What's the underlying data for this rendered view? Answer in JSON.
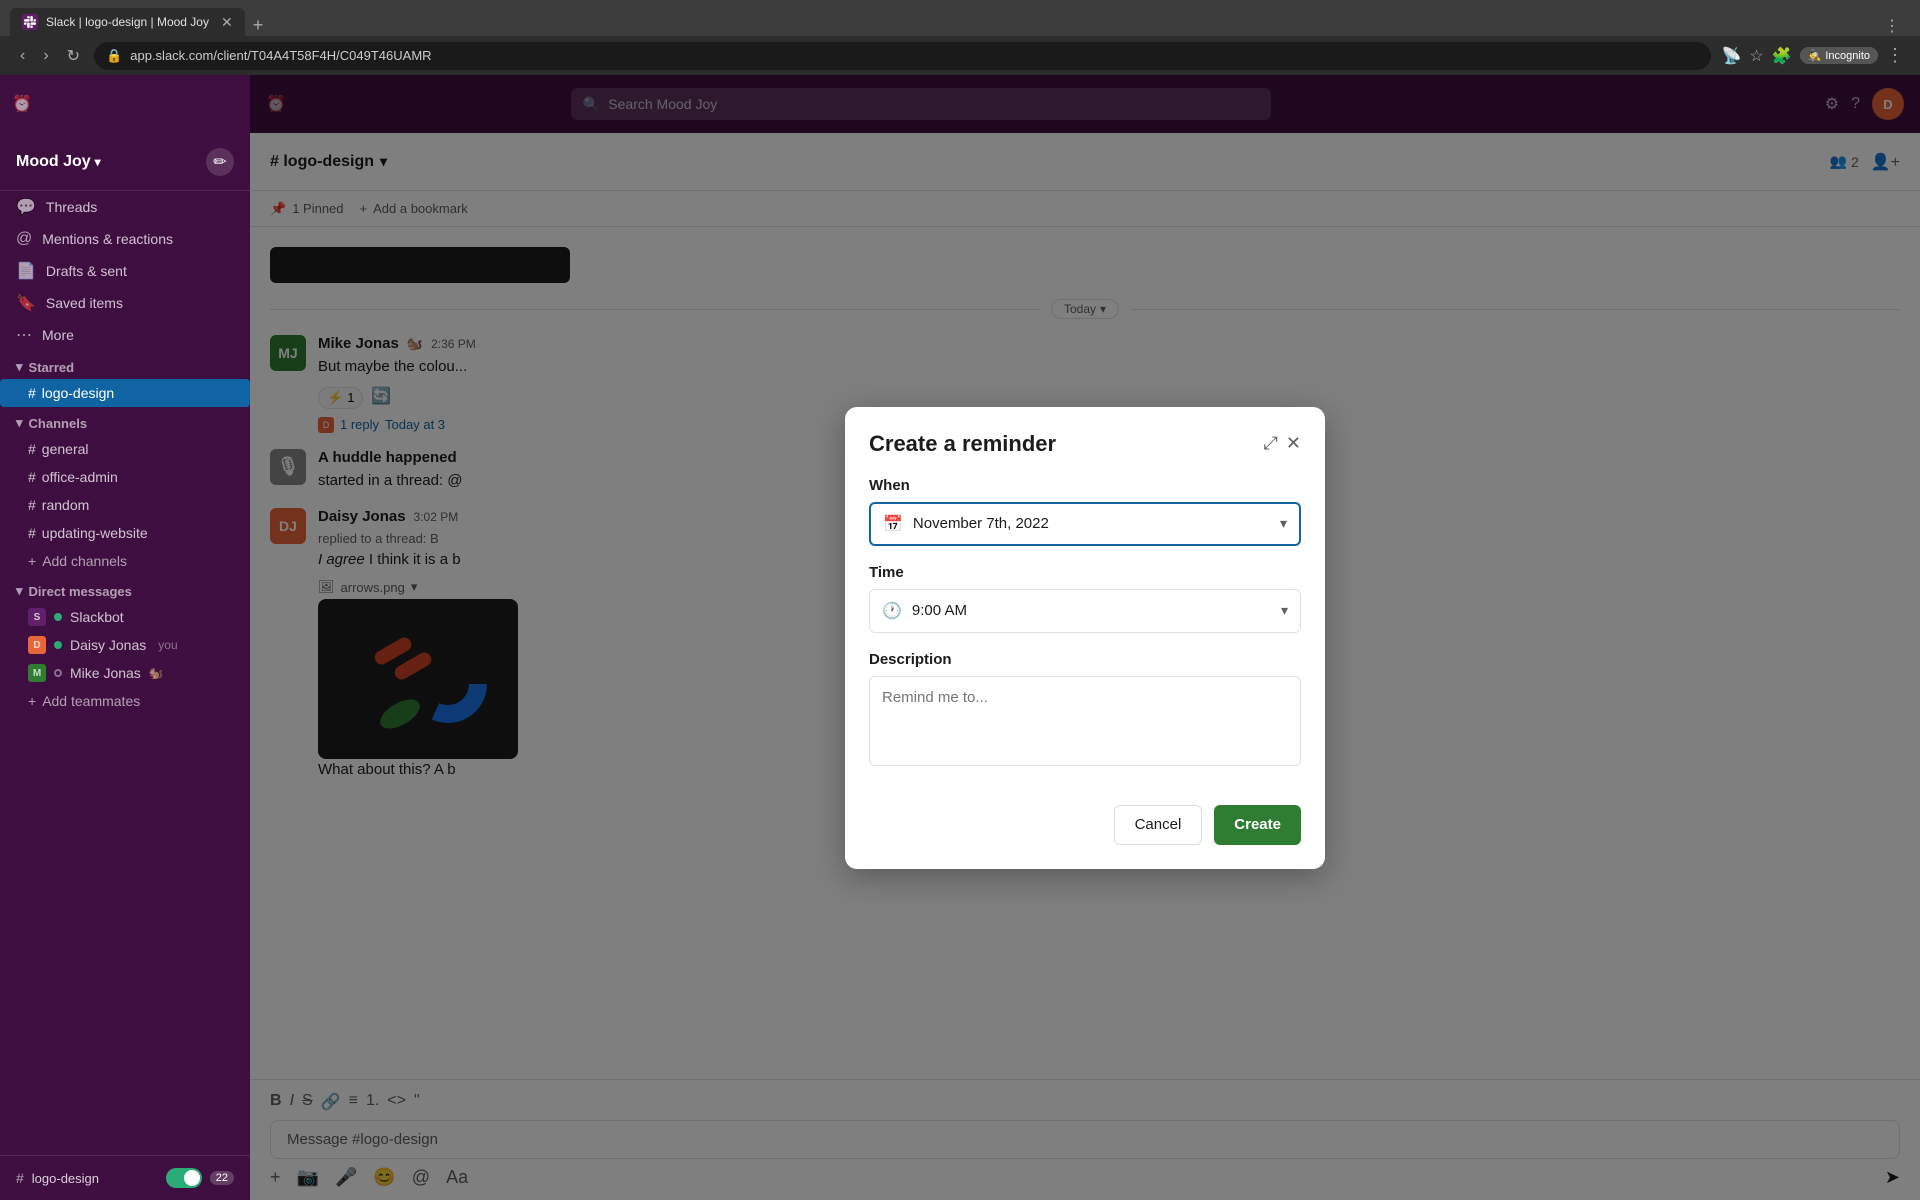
{
  "browser": {
    "tab_title": "Slack | logo-design | Mood Joy",
    "address": "app.slack.com/client/T04A4T58F4H/C049T46UAMR",
    "new_tab_label": "+",
    "incognito_label": "Incognito"
  },
  "topbar": {
    "search_placeholder": "Search Mood Joy",
    "history_icon": "⏰"
  },
  "sidebar": {
    "workspace_name": "Mood Joy",
    "nav_items": [
      {
        "id": "threads",
        "label": "Threads",
        "icon": "💬"
      },
      {
        "id": "mentions",
        "label": "Mentions & reactions",
        "icon": "🔔"
      },
      {
        "id": "drafts",
        "label": "Drafts & sent",
        "icon": "📄"
      },
      {
        "id": "saved",
        "label": "Saved items",
        "icon": "🔖"
      },
      {
        "id": "more",
        "label": "More",
        "icon": "•••"
      }
    ],
    "starred_section": "Starred",
    "starred_channels": [
      {
        "id": "logo-design",
        "label": "logo-design",
        "active": true
      }
    ],
    "channels_section": "Channels",
    "channels": [
      {
        "id": "general",
        "label": "general"
      },
      {
        "id": "office-admin",
        "label": "office-admin"
      },
      {
        "id": "random",
        "label": "random"
      },
      {
        "id": "updating-website",
        "label": "updating-website"
      }
    ],
    "add_channels_label": "Add channels",
    "dm_section": "Direct messages",
    "dms": [
      {
        "id": "slackbot",
        "label": "Slackbot",
        "color": "#611f69",
        "initials": "S",
        "active": true
      },
      {
        "id": "daisy",
        "label": "Daisy Jonas",
        "sub": "you",
        "color": "#e8643b",
        "initials": "DJ",
        "active": true
      },
      {
        "id": "mike",
        "label": "Mike Jonas",
        "emoji": "🐿️",
        "color": "#2e7d32",
        "initials": "MJ",
        "active": false
      }
    ],
    "add_teammates_label": "Add teammates",
    "footer_channel": "logo-design",
    "footer_badge": "22"
  },
  "channel": {
    "name": "# logo-design",
    "pinned_count": "1 Pinned",
    "add_bookmark": "Add a bookmark",
    "member_count": "2",
    "today_label": "Today",
    "date_label": "Today"
  },
  "messages": [
    {
      "id": "msg1",
      "author": "Mike Jonas",
      "author_emoji": "🐿️",
      "time": "2:36 PM",
      "text": "But maybe the colou...",
      "avatar_color": "#2e7d32",
      "initials": "MJ",
      "reply_count": "1 reply",
      "reply_time": "Today at 3",
      "reaction_emoji": "⚡",
      "reaction_count": "1"
    },
    {
      "id": "msg2",
      "author": "A huddle happened",
      "time": "",
      "text": "started in a thread: @",
      "avatar_color": "#888",
      "initials": "🎙",
      "is_huddle": true
    },
    {
      "id": "msg3",
      "author": "Daisy Jonas",
      "time": "3:02 PM",
      "text_italic": "I agree",
      "text_rest": " I think it is a b",
      "avatar_color": "#e8643b",
      "initials": "DJ",
      "sub": "replied to a thread: B",
      "bottom_text": "What about this? A b"
    }
  ],
  "message_input": {
    "placeholder": "Message #logo-design"
  },
  "dialog": {
    "title": "Create a reminder",
    "when_label": "When",
    "when_value": "November 7th, 2022",
    "time_label": "Time",
    "time_value": "9:00 AM",
    "description_label": "Description",
    "description_placeholder": "Remind me to...",
    "cancel_label": "Cancel",
    "create_label": "Create"
  }
}
